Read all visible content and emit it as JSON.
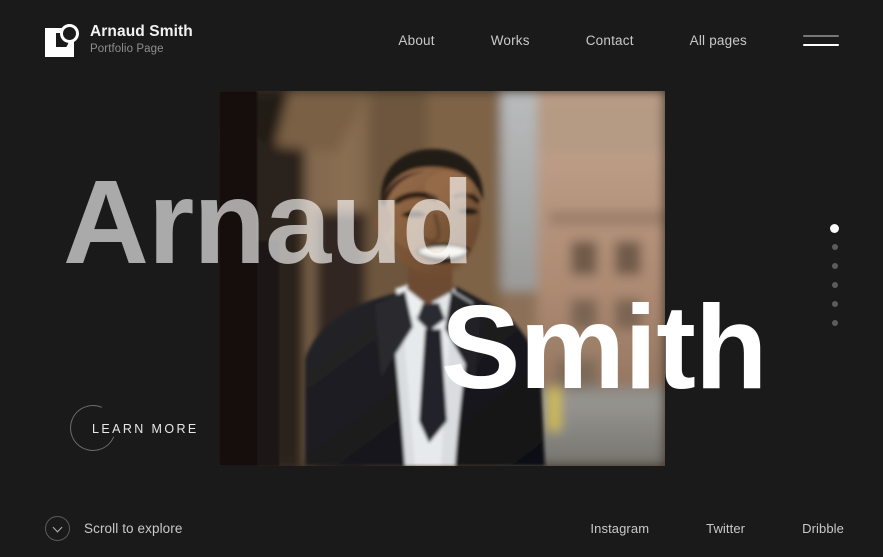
{
  "theme": {
    "background": "#1a1a1a",
    "text_primary": "#f2f2f2",
    "text_muted": "#8e8e8e",
    "accent": "#ffffff"
  },
  "header": {
    "logo_icon": "camera-square-logo",
    "brand_name": "Arnaud Smith",
    "brand_subtitle": "Portfolio Page",
    "nav": [
      {
        "label": "About"
      },
      {
        "label": "Works"
      },
      {
        "label": "Contact"
      },
      {
        "label": "All pages"
      }
    ],
    "menu_icon": "hamburger-menu-icon"
  },
  "hero": {
    "title_first": "Arnaud",
    "title_last": "Smith",
    "cta_label": "LEARN MORE",
    "cta_icon": "circle-outline-icon",
    "photo_alt": "man-in-dark-suit-on-city-street"
  },
  "slider": {
    "dots": [
      {
        "active": true
      },
      {
        "active": false
      },
      {
        "active": false
      },
      {
        "active": false
      },
      {
        "active": false
      },
      {
        "active": false
      }
    ]
  },
  "footer": {
    "scroll_icon": "chevron-down-icon",
    "scroll_label": "Scroll to explore",
    "socials": [
      {
        "label": "Instagram"
      },
      {
        "label": "Twitter"
      },
      {
        "label": "Dribble"
      }
    ]
  }
}
